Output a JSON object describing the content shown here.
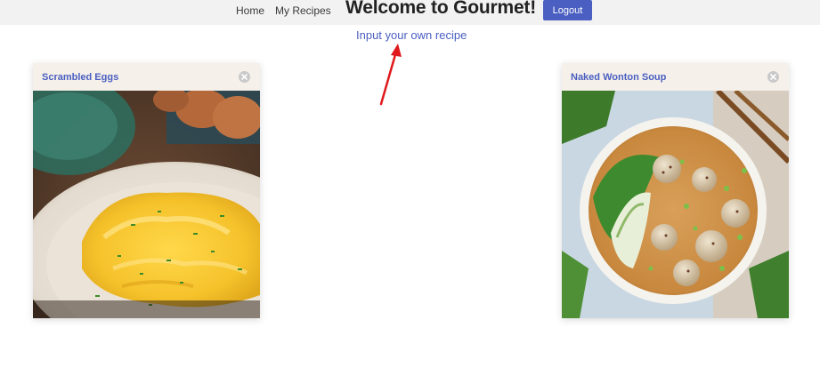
{
  "nav": {
    "home_label": "Home",
    "recipes_label": "My Recipes",
    "site_title": "Welcome to Gourmet!",
    "logout_label": "Logout"
  },
  "main": {
    "input_link": "Input your own recipe"
  },
  "cards": [
    {
      "title": "Scrambled Eggs",
      "close_icon": "close-icon"
    },
    {
      "title": "Naked Wonton Soup",
      "close_icon": "close-icon"
    }
  ],
  "colors": {
    "accent": "#4a5fc1",
    "navbar_bg": "#f2f2f3",
    "card_header_bg": "#f5f0ea",
    "arrow": "#e0191c"
  }
}
